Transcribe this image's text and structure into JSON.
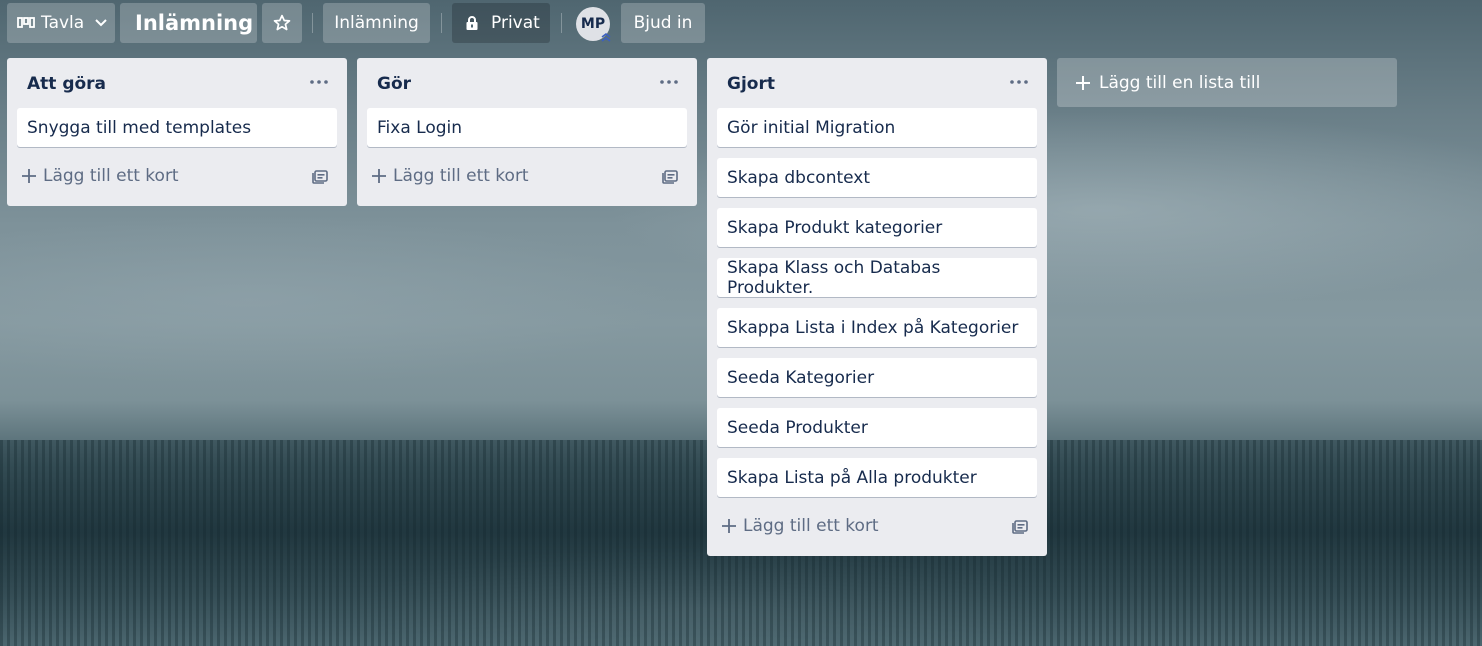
{
  "header": {
    "view_switcher": "Tavla",
    "board_title": "Inlämning",
    "workspace": "Inlämning",
    "visibility": "Privat",
    "member_initials": "MP",
    "invite_label": "Bjud in"
  },
  "lists": [
    {
      "title": "Att göra",
      "cards": [
        "Snygga till med templates"
      ],
      "add_card": "Lägg till ett kort"
    },
    {
      "title": "Gör",
      "cards": [
        "Fixa Login"
      ],
      "add_card": "Lägg till ett kort"
    },
    {
      "title": "Gjort",
      "cards": [
        "Gör initial Migration",
        "Skapa dbcontext",
        "Skapa Produkt kategorier",
        "Skapa Klass och Databas Produkter.",
        "Skappa Lista i Index på Kategorier",
        "Seeda Kategorier",
        "Seeda Produkter",
        "Skapa Lista på Alla produkter"
      ],
      "add_card": "Lägg till ett kort"
    }
  ],
  "add_list_label": "Lägg till en lista till",
  "colors": {
    "list_bg": "#ebecf0",
    "text": "#172b4d",
    "muted": "#5e6c84"
  }
}
